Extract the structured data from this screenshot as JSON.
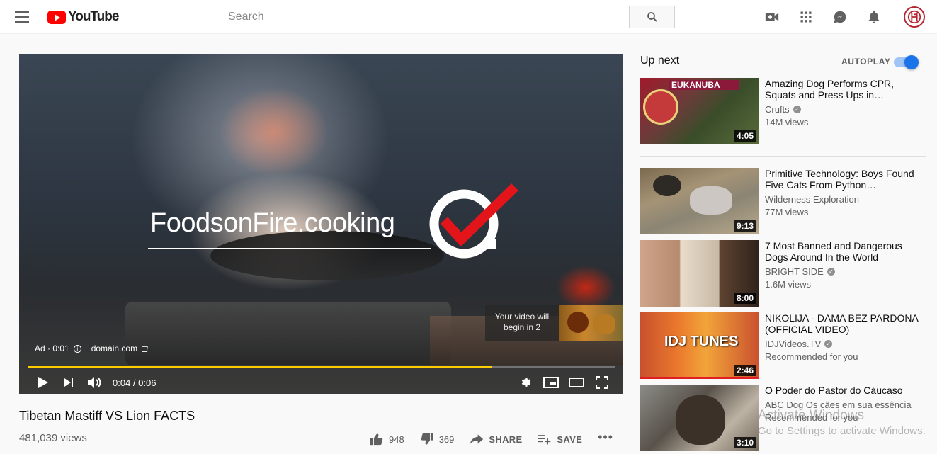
{
  "masthead": {
    "logo_text": "YouTube",
    "search_placeholder": "Search",
    "icons": [
      "menu-icon",
      "video-camera-icon",
      "apps-grid-icon",
      "messages-icon",
      "bell-icon"
    ]
  },
  "player": {
    "ad_brand": "FoodsonFire.cooking",
    "preview_text": "Your video will begin in 2",
    "ad_label": "Ad · 0:01",
    "ad_domain": "domain.com",
    "time": "0:04 / 0:06",
    "progress": 0.79,
    "accent_color": "#ffcc00"
  },
  "video": {
    "title": "Tibetan Mastiff VS Lion FACTS",
    "views": "481,039 views",
    "likes": "948",
    "dislikes": "369",
    "share_label": "SHARE",
    "save_label": "SAVE",
    "more_label": "•••"
  },
  "sidebar": {
    "up_next": "Up next",
    "autoplay": "AUTOPLAY",
    "autoplay_on": true,
    "items": [
      {
        "title": "Amazing Dog Performs CPR, Squats and Press Ups in…",
        "channel": "Crufts",
        "verified": true,
        "meta": "14M views",
        "duration": "4:05",
        "badge": "Crufts",
        "band": "EUKANUBA"
      },
      {
        "title": "Primitive Technology: Boys Found Five Cats From Python…",
        "channel": "Wilderness Exploration",
        "verified": false,
        "meta": "77M views",
        "duration": "9:13"
      },
      {
        "title": "7 Most Banned and Dangerous Dogs Around In the World",
        "channel": "BRIGHT SIDE",
        "verified": true,
        "meta": "1.6M views",
        "duration": "8:00"
      },
      {
        "title": "NIKOLIJA - DAMA BEZ PARDONA (OFFICIAL VIDEO)",
        "channel": "IDJVideos.TV",
        "verified": true,
        "meta": "Recommended for you",
        "duration": "2:46",
        "logo": "IDJ TUNES"
      },
      {
        "title": "O Poder do Pastor do Cáucaso",
        "channel": "ABC Dog Os cães em sua essência",
        "verified": false,
        "meta": "Recommended for you",
        "duration": "3:10"
      }
    ]
  },
  "watermark": {
    "line1": "Activate Windows",
    "line2": "Go to Settings to activate Windows."
  }
}
